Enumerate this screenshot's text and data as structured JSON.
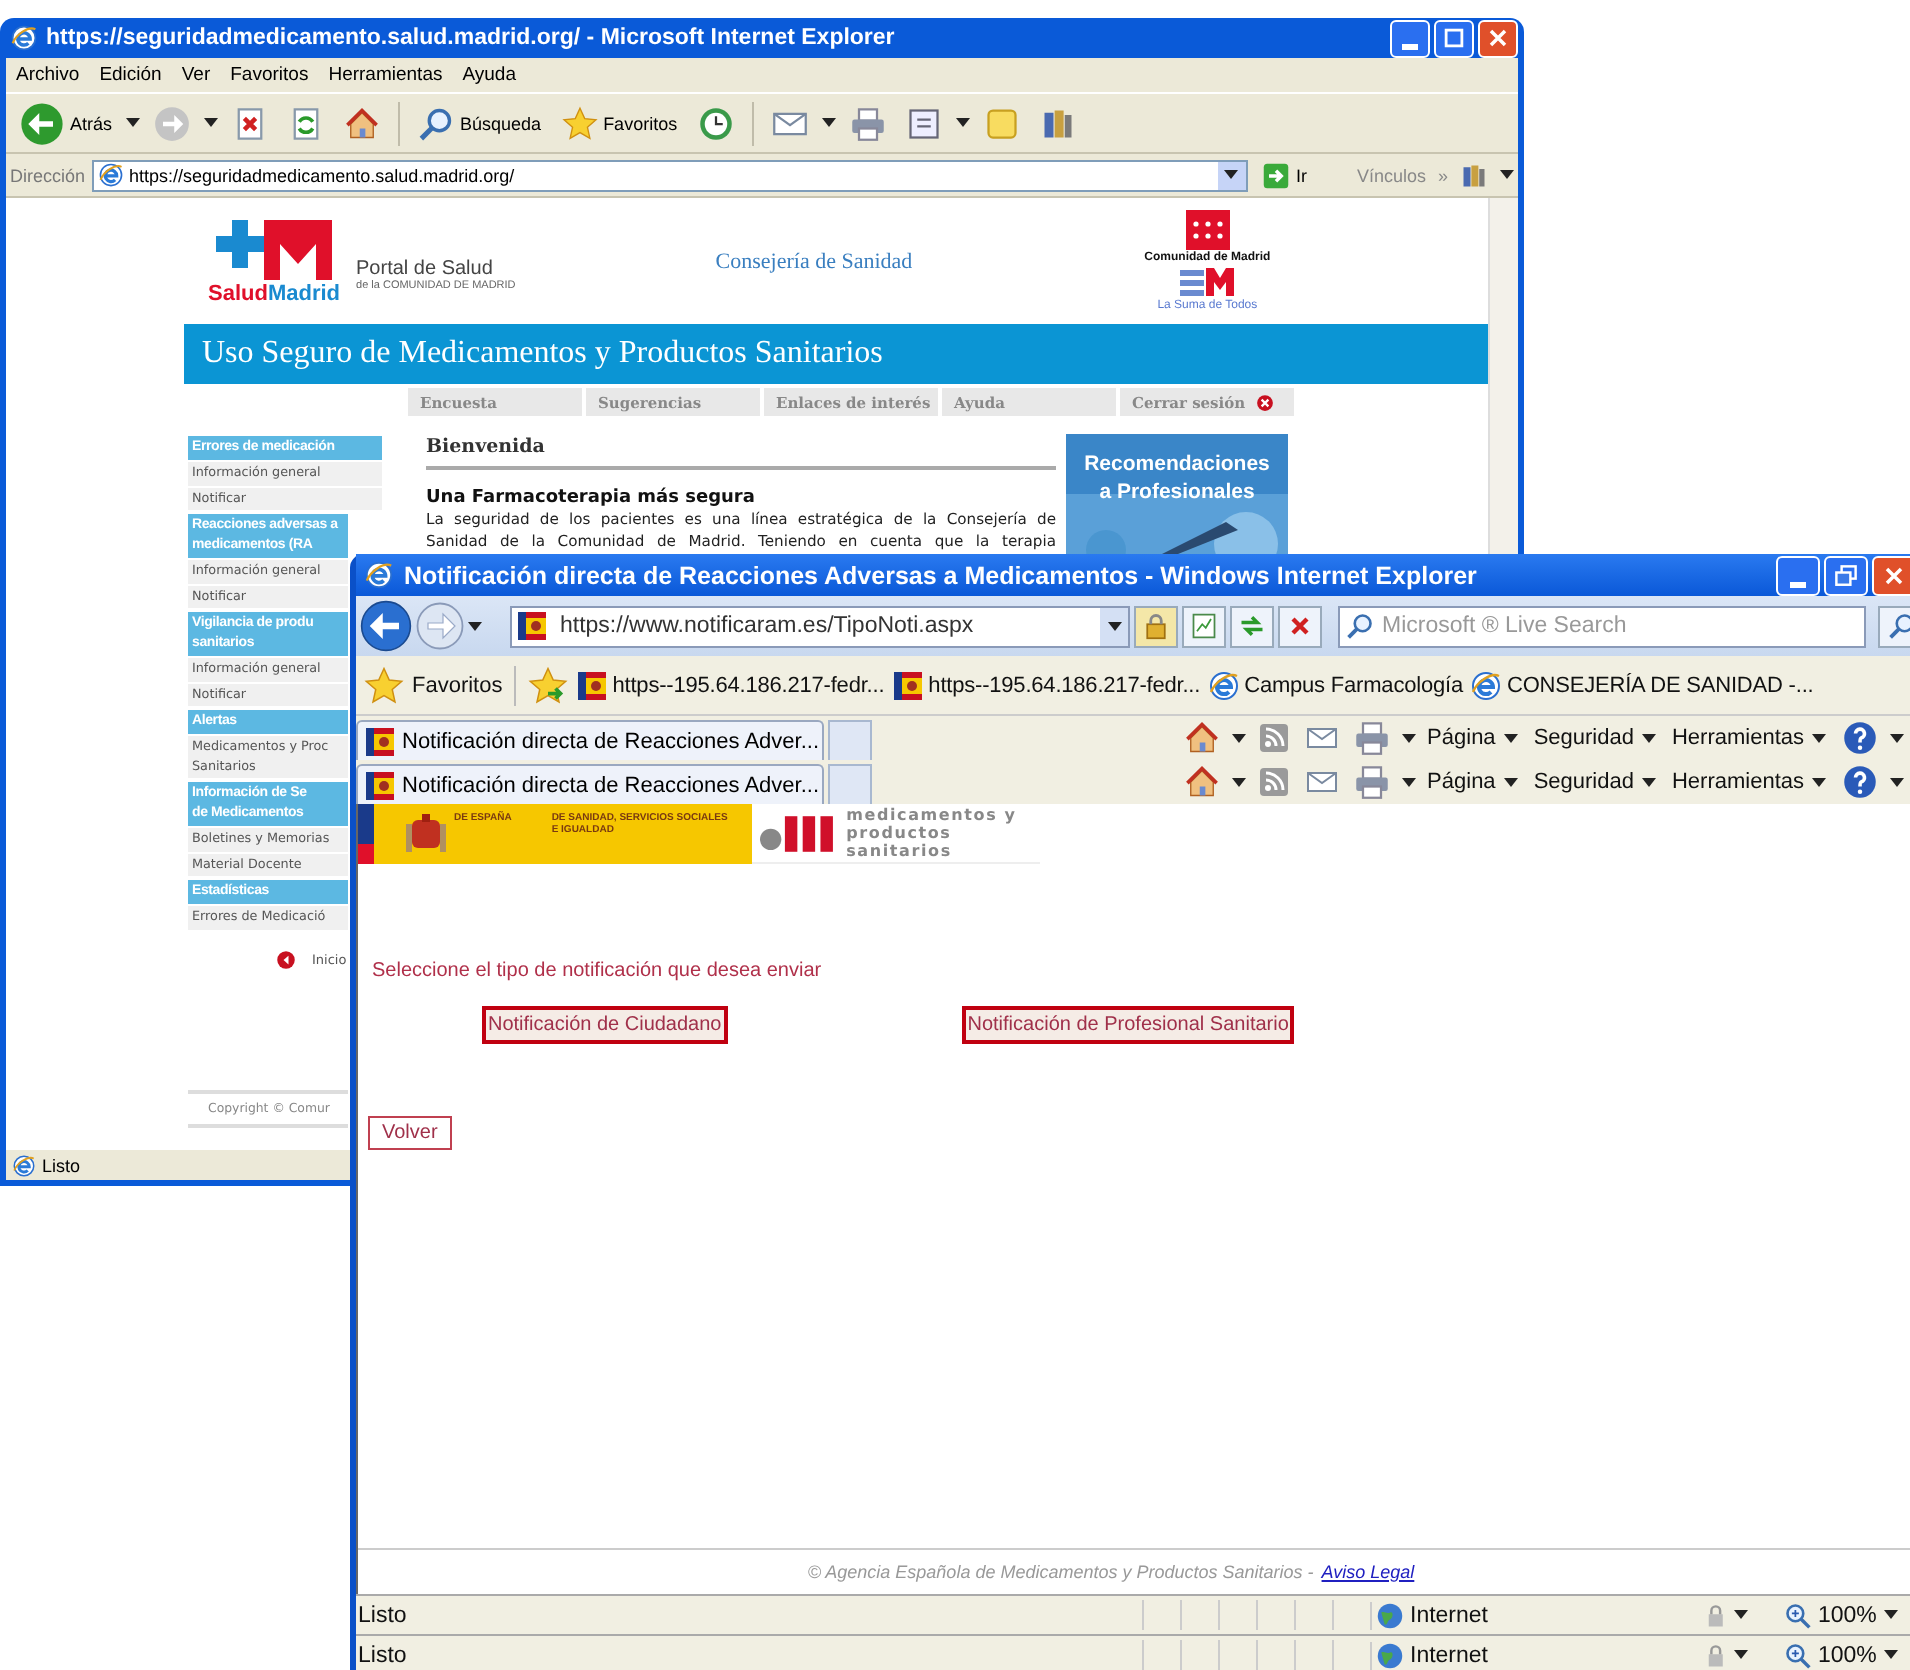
{
  "back_window": {
    "title": "https://seguridadmedicamento.salud.madrid.org/ - Microsoft Internet Explorer",
    "menu": [
      "Archivo",
      "Edición",
      "Ver",
      "Favoritos",
      "Herramientas",
      "Ayuda"
    ],
    "toolbar": [
      {
        "kind": "back",
        "label": "Atrás",
        "dropdown": true
      },
      {
        "kind": "forward",
        "dropdown": true
      },
      {
        "kind": "stop"
      },
      {
        "kind": "refresh"
      },
      {
        "kind": "home"
      },
      {
        "kind": "search",
        "label": "Búsqueda"
      },
      {
        "kind": "favorites",
        "label": "Favoritos"
      },
      {
        "kind": "history"
      },
      {
        "kind": "mail",
        "dropdown": true
      },
      {
        "kind": "print"
      },
      {
        "kind": "edit",
        "dropdown": true
      },
      {
        "kind": "notes"
      },
      {
        "kind": "research"
      }
    ],
    "address": {
      "label": "Dirección",
      "url": "https://seguridadmedicamento.salud.madrid.org/",
      "go": "Ir",
      "links": "Vínculos",
      "more": "»"
    },
    "page": {
      "brand_a": "Salud",
      "brand_b": "Madrid",
      "portal": "Portal de Salud",
      "portal_sub": "de la COMUNIDAD DE MADRID",
      "department": "Consejería de Sanidad",
      "region": "Comunidad de Madrid",
      "slogan": "La Suma de Todos",
      "banner": "Uso Seguro de Medicamentos y Productos Sanitarios",
      "nav": [
        {
          "kind": "link",
          "label": "Encuesta"
        },
        {
          "kind": "link",
          "label": "Sugerencias"
        },
        {
          "kind": "link",
          "label": "Enlaces de interés"
        },
        {
          "kind": "link",
          "label": "Ayuda"
        },
        {
          "kind": "logout",
          "label": "Cerrar sesión"
        }
      ],
      "sidebar": [
        {
          "kind": "header",
          "lines": [
            "Errores de medicación"
          ]
        },
        {
          "kind": "item",
          "lines": [
            "Información general"
          ]
        },
        {
          "kind": "item",
          "lines": [
            "Notificar"
          ]
        },
        {
          "kind": "header",
          "lines": [
            "Reacciones adversas a",
            "medicamentos (RA"
          ]
        },
        {
          "kind": "item",
          "lines": [
            "Información general"
          ]
        },
        {
          "kind": "item",
          "lines": [
            "Notificar"
          ]
        },
        {
          "kind": "header",
          "lines": [
            "Vigilancia de produ",
            "sanitarios"
          ]
        },
        {
          "kind": "item",
          "lines": [
            "Información general"
          ]
        },
        {
          "kind": "item",
          "lines": [
            "Notificar"
          ]
        },
        {
          "kind": "header",
          "lines": [
            "Alertas"
          ]
        },
        {
          "kind": "item",
          "lines": [
            "Medicamentos y Proc",
            "Sanitarios"
          ]
        },
        {
          "kind": "header",
          "lines": [
            "Información de Se",
            "de Medicamentos"
          ]
        },
        {
          "kind": "item",
          "lines": [
            "Boletines y Memorias"
          ]
        },
        {
          "kind": "item",
          "lines": [
            "Material Docente"
          ]
        },
        {
          "kind": "header",
          "lines": [
            "Estadísticas"
          ]
        },
        {
          "kind": "item",
          "lines": [
            "Errores de Medicació"
          ]
        }
      ],
      "home_link": "Inicio",
      "copyright": "Copyright © Comur",
      "welcome": "Bienvenida",
      "article_title": "Una Farmacoterapia más segura",
      "article_lines": [
        "La seguridad de los pacientes es una línea estratégica de la Consejería de",
        "Sanidad de la Comunidad de Madrid. Teniendo en cuenta que la terapia"
      ],
      "promo_lines": [
        "Recomendaciones",
        "a Profesionales"
      ]
    },
    "status": "Listo"
  },
  "front_window": {
    "title": "Notificación directa de Reacciones Adversas a Medicamentos - Windows Internet Explorer",
    "url": "https://www.notificaram.es/TipoNoti.aspx",
    "search_placeholder": "Microsoft ® Live Search",
    "favorites_label": "Favoritos",
    "favorites": [
      {
        "kind": "site",
        "label": "https--195.64.186.217-fedr..."
      },
      {
        "kind": "site",
        "label": "https--195.64.186.217-fedr..."
      },
      {
        "kind": "ie",
        "label": "Campus Farmacología"
      },
      {
        "kind": "ie",
        "label": "CONSEJERÍA DE SANIDAD -..."
      }
    ],
    "tab_rows": [
      {
        "tab": "Notificación directa de Reacciones Adver...",
        "commands": [
          "Página",
          "Seguridad",
          "Herramientas"
        ]
      },
      {
        "tab": "Notificación directa de Reacciones Adver...",
        "commands": [
          "Página",
          "Seguridad",
          "Herramientas"
        ]
      }
    ],
    "page": {
      "gov_name": "DE ESPAÑA",
      "ministry_lines": [
        "DE SANIDAD, SERVICIOS SOCIALES",
        "E IGUALDAD"
      ],
      "agency_lines": [
        "medicamentos y",
        "productos sanitarios"
      ],
      "prompt": "Seleccione el tipo de notificación que desea enviar",
      "options": [
        "Notificación de Ciudadano",
        "Notificación de Profesional Sanitario"
      ],
      "back": "Volver",
      "footer": "© Agencia Española de Medicamentos y Productos Sanitarios  -",
      "footer_link": "Aviso Legal"
    },
    "status_bars": [
      {
        "text": "Listo",
        "zone": "Internet",
        "zoom": "100%"
      },
      {
        "text": "Listo",
        "zone": "Internet",
        "zoom": "100%"
      }
    ]
  }
}
